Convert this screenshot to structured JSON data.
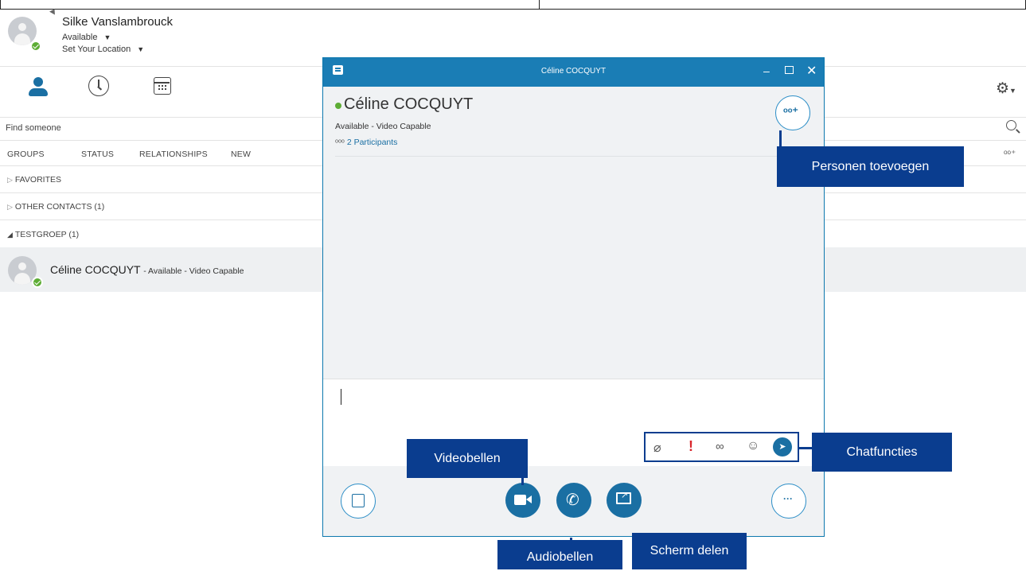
{
  "user": {
    "name": "Silke Vanslambrouck",
    "status": "Available",
    "location": "Set Your Location"
  },
  "search": {
    "placeholder": "Find someone"
  },
  "tabs": [
    "GROUPS",
    "STATUS",
    "RELATIONSHIPS",
    "NEW"
  ],
  "groups": [
    {
      "label": "FAVORITES",
      "expanded": false
    },
    {
      "label": "OTHER CONTACTS (1)",
      "expanded": false
    },
    {
      "label": "TESTGROEP (1)",
      "expanded": true
    }
  ],
  "contact": {
    "name": "Céline COCQUYT",
    "status_suffix": "- Available - Video Capable"
  },
  "chat": {
    "window_title": "Céline COCQUYT",
    "contact_name": "Céline COCQUYT",
    "contact_status": "Available - Video Capable",
    "participants": "2 Participants"
  },
  "callouts": {
    "add_people": "Personen toevoegen",
    "chat_functions": "Chatfuncties",
    "video_call": "Videobellen",
    "audio_call": "Audiobellen",
    "share_screen": "Scherm delen"
  },
  "colors": {
    "accent": "#1a7db5",
    "button_blue": "#1a6fa3",
    "callout": "#0a3d8f",
    "presence_green": "#5dad35",
    "urgent_red": "#d9262c"
  }
}
